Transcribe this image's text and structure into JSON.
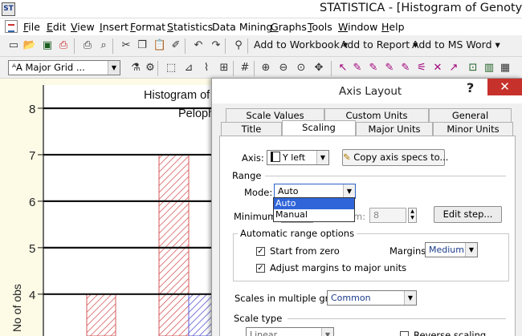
{
  "window": {
    "app_icon_label": "ST",
    "title": "STATISTICA - [Histogram of Genotyp; cate"
  },
  "menu": {
    "items": [
      {
        "key": "F",
        "rest": "ile"
      },
      {
        "key": "E",
        "rest": "dit"
      },
      {
        "key": "V",
        "rest": "iew"
      },
      {
        "key": "I",
        "rest": "nsert"
      },
      {
        "key": "F",
        "rest": "ormat"
      },
      {
        "key": "S",
        "rest": "tatistics"
      },
      {
        "key": "",
        "rest": "Data Mining"
      },
      {
        "key": "G",
        "rest": "raphs"
      },
      {
        "key": "T",
        "rest": "ools"
      },
      {
        "key": "W",
        "rest": "indow"
      },
      {
        "key": "H",
        "rest": "elp"
      }
    ]
  },
  "toolbar1": {
    "icons": [
      "new-icon",
      "open-folder-icon",
      "save-icon",
      "pdf-icon",
      "print-icon",
      "print-preview-icon",
      "cut-icon",
      "copy-icon",
      "paste-icon",
      "format-painter-icon",
      "undo-icon",
      "redo-icon",
      "binoculars-icon"
    ],
    "add_to_workbook": "Add to Workbook",
    "add_to_report": "Add to Report",
    "add_to_ms_word": "Add to MS Word",
    "dropdown_glyph": "▾"
  },
  "toolbar2": {
    "grid_combo_icon": "ᴬA",
    "grid_combo_value": "Major Grid ...",
    "icons": [
      "graph-data-icon",
      "graph-options-icon",
      "select-region-icon",
      "axis-icon",
      "line-chart-icon",
      "insert-chart-icon",
      "grid-icon",
      "zoom-in-icon",
      "zoom-out-icon",
      "zoom-fit-icon",
      "pan-icon",
      "pointer-icon",
      "brush-icon",
      "brush-point-icon",
      "brush-lasso-icon",
      "brush-box-icon",
      "brush-wand-icon",
      "brush-x-icon",
      "brush-cursor-icon",
      "lock-icon",
      "camera-icon",
      "table-icon"
    ]
  },
  "chart_data": {
    "type": "bar",
    "title": "Histogram of",
    "subtitle": "Peloph",
    "ylabel": "No of obs",
    "ylim": [
      3.1,
      8.5
    ],
    "yticks": [
      4,
      5,
      6,
      7,
      8
    ],
    "grid": true,
    "bars": [
      {
        "value": 4,
        "color": "#d65a5a",
        "hatch": "diagonal"
      },
      {
        "value": 7,
        "color": "#d65a5a",
        "hatch": "diagonal"
      },
      {
        "value": 4,
        "color": "#5a5ad6",
        "hatch": "diagonal"
      }
    ]
  },
  "dialog": {
    "title": "Axis Layout",
    "help": "?",
    "close": "✕",
    "tabs_back": [
      "Scale Values",
      "Custom Units",
      "General"
    ],
    "tabs_front": [
      "Title",
      "Scaling",
      "Major Units",
      "Minor Units"
    ],
    "active_tab": "Scaling",
    "axis_label": "Axis:",
    "axis_value": "Y left",
    "copy_specs": "Copy axis specs to...",
    "range_label": "Range",
    "mode_label": "Mode:",
    "mode_value": "Auto",
    "mode_options": [
      "Auto",
      "Manual"
    ],
    "minimum_label": "Minimum:",
    "maximum_label": "m:",
    "maximum_value": "8",
    "edit_step": "Edit step...",
    "auto_range_title": "Automatic range options",
    "start_from_zero": "Start from zero",
    "margins_label": "Margins:",
    "margins_value": "Medium",
    "adjust_margins": "Adjust margins to major units",
    "scales_multiple_label": "Scales in multiple graph:",
    "scales_multiple_value": "Common",
    "scale_type_label": "Scale type",
    "scale_type_value": "Linear",
    "reverse_scaling": "Reverse scaling"
  }
}
